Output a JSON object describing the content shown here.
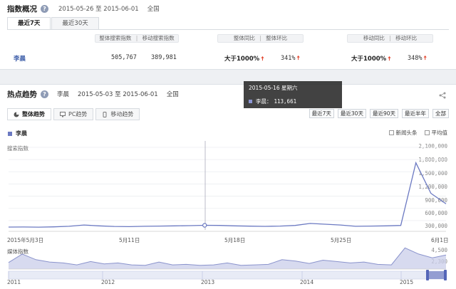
{
  "overview": {
    "title": "指数概况",
    "date_range": "2015-05-26 至 2015-06-01",
    "region": "全国",
    "tabs": [
      {
        "label": "最近7天",
        "active": true
      },
      {
        "label": "最近30天",
        "active": false
      }
    ],
    "headers": {
      "overall_search": "整体搜索指数",
      "mobile_search": "移动搜索指数",
      "overall_yoy": "整体同比",
      "overall_mom": "整体环比",
      "mobile_yoy": "移动同比",
      "mobile_mom": "移动环比",
      "separator": "|"
    },
    "row": {
      "keyword": "李晨",
      "overall_search": "505,767",
      "mobile_search": "389,981",
      "overall_yoy": "大于1000%",
      "overall_mom": "341%",
      "mobile_yoy": "大于1000%",
      "mobile_mom": "348%",
      "up_arrow": "🠅"
    }
  },
  "trend": {
    "title": "热点趋势",
    "keyword": "李晨",
    "date_range": "2015-05-03 至 2015-06-01",
    "region": "全国",
    "tabs": [
      {
        "label": "整体趋势",
        "active": true,
        "icon": "pie-icon"
      },
      {
        "label": "PC趋势",
        "active": false,
        "icon": "monitor-icon"
      },
      {
        "label": "移动趋势",
        "active": false,
        "icon": "mobile-icon"
      }
    ],
    "ranges": [
      "最近7天",
      "最近30天",
      "最近90天",
      "最近半年",
      "全部"
    ],
    "legend": "李晨",
    "checkboxes": [
      "新闻头条",
      "平均值"
    ],
    "y_axis_title": "搜索指数",
    "media_title": "媒体指数",
    "tooltip": {
      "date": "2015-05-16 星期六",
      "name": "李晨：",
      "value": "113,661"
    },
    "colors": {
      "line": "#6b79c2",
      "fill": "#c9cdea",
      "up": "#e2442c"
    }
  },
  "chart_data": [
    {
      "type": "line",
      "title": "",
      "ylabel": "搜索指数",
      "y_ticks": [
        "2,100,000",
        "1,800,000",
        "1,500,000",
        "1,200,000",
        "900,000",
        "600,000",
        "300,000"
      ],
      "x_ticks": [
        "2015年5月3日",
        "5月11日",
        "5月18日",
        "5月25日",
        "6月1日"
      ],
      "ylim": [
        0,
        2100000
      ],
      "x": [
        "5-3",
        "5-4",
        "5-5",
        "5-6",
        "5-7",
        "5-8",
        "5-9",
        "5-10",
        "5-11",
        "5-12",
        "5-13",
        "5-14",
        "5-15",
        "5-16",
        "5-17",
        "5-18",
        "5-19",
        "5-20",
        "5-21",
        "5-22",
        "5-23",
        "5-24",
        "5-25",
        "5-26",
        "5-27",
        "5-28",
        "5-29",
        "5-30",
        "5-31",
        "6-1"
      ],
      "series": [
        {
          "name": "李晨",
          "values": [
            70000,
            72000,
            68000,
            75000,
            90000,
            120000,
            100000,
            85000,
            80000,
            90000,
            95000,
            100000,
            105000,
            113661,
            110000,
            100000,
            92000,
            88000,
            95000,
            110000,
            160000,
            140000,
            120000,
            90000,
            95000,
            100000,
            110000,
            1650000,
            900000,
            640000
          ]
        }
      ]
    },
    {
      "type": "area",
      "title": "",
      "ylabel": "媒体指数",
      "y_ticks": [
        "4,500",
        "2,300"
      ],
      "x_ticks": [
        "2011",
        "2012",
        "2013",
        "2014",
        "2015"
      ],
      "ylim": [
        0,
        5000
      ],
      "series": [
        {
          "name": "李晨",
          "values": [
            1400,
            3200,
            2000,
            1500,
            1300,
            900,
            1600,
            1100,
            1300,
            900,
            800,
            1500,
            900,
            1000,
            800,
            900,
            1300,
            800,
            900,
            1000,
            2000,
            1700,
            1200,
            1900,
            1600,
            1300,
            1500,
            1000,
            900,
            4500,
            3200,
            2400,
            3000
          ]
        }
      ]
    }
  ]
}
